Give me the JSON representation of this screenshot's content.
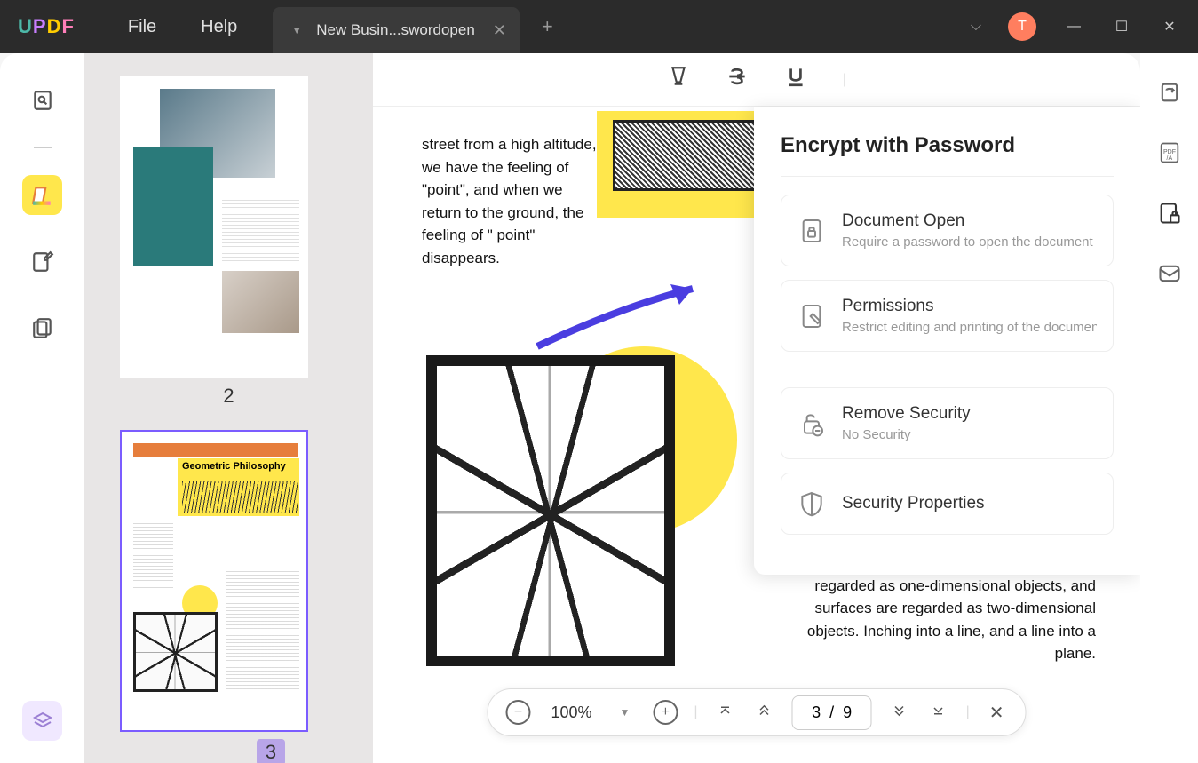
{
  "menu": {
    "file": "File",
    "help": "Help"
  },
  "tab": {
    "title": "New Busin...swordopen"
  },
  "avatar": "T",
  "thumbnails": [
    {
      "page": "2"
    },
    {
      "page": "3",
      "title": "Geometric Philosophy"
    }
  ],
  "doc": {
    "text1": "street from a high altitude, we have the feeling of \"point\", and when we return to the ground, the feeling of \" point\" disappears.",
    "text2": "the most basic component in geometry. In the usual sense, points are regarded as zero-dimensional objects, lines are regarded as one-dimensional objects, and surfaces are regarded as two-dimensional objects. Inching into a line, and a line into a plane."
  },
  "encrypt": {
    "title": "Encrypt with Password",
    "options": [
      {
        "title": "Document Open",
        "sub": "Require a password to open the document"
      },
      {
        "title": "Permissions",
        "sub": "Restrict editing and printing of the document"
      },
      {
        "title": "Remove Security",
        "sub": "No Security"
      },
      {
        "title": "Security Properties",
        "sub": ""
      }
    ]
  },
  "zoom": {
    "level": "100%"
  },
  "page": {
    "display": "3  /  9"
  }
}
